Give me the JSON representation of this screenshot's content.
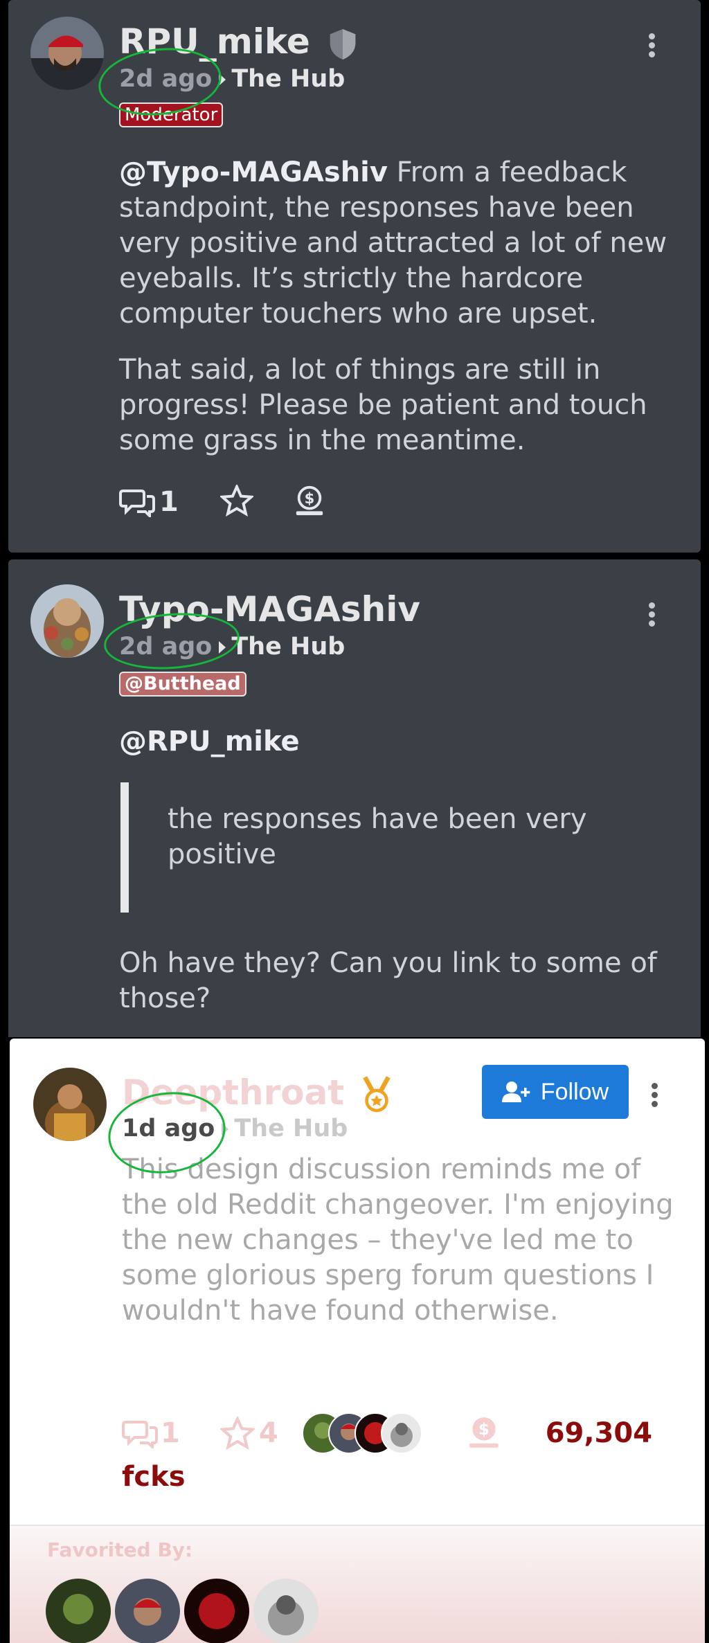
{
  "comments": [
    {
      "author": "RPU_mike",
      "time": "2d ago",
      "community": "The Hub",
      "badge": "Moderator",
      "mention": "@Typo-MAGAshiv",
      "paragraphs": [
        "From a feedback standpoint, the responses have been very positive and attracted a lot of new eyeballs. It’s strictly the hardcore computer touchers who are upset.",
        "That said, a lot of things are still in progress! Please be patient and touch some grass in the meantime."
      ],
      "reply_count": "1"
    },
    {
      "author": "Typo-MAGAshiv",
      "time": "2d ago",
      "community": "The Hub",
      "badge": "@Butthead",
      "mention": "@RPU_mike",
      "quote": "the responses have been very positive",
      "text": "Oh have they? Can you link to some of those?"
    },
    {
      "author": "Deepthroat",
      "time": "1d ago",
      "community": "The Hub",
      "follow_label": "Follow",
      "text": "This design discussion reminds me of the old Reddit changeover. I'm enjoying the new changes – they've led me to some glorious sperg forum questions I wouldn't have found otherwise.",
      "reply_count": "1",
      "favorite_count": "4",
      "award_amount": "69,304",
      "award_unit": "fcks",
      "favorited_by_label": "Favorited By:"
    }
  ],
  "colors": {
    "card_dark": "#3b3f46",
    "moderator_badge": "#a3121f",
    "user_badge": "#b86a6a",
    "follow_button": "#1e7ad9",
    "award_red": "#8c0c0c",
    "annotation_green": "#15b63a"
  },
  "icons": [
    "shield-icon",
    "kebab-menu-icon",
    "reply-icon",
    "star-icon",
    "tip-coin-icon",
    "medal-icon",
    "add-user-icon"
  ]
}
